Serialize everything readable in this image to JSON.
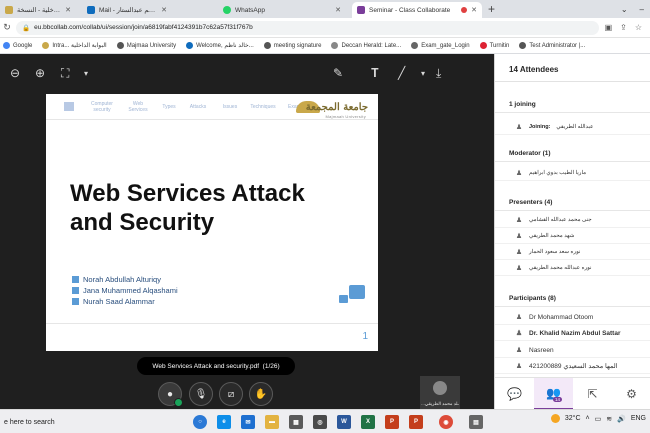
{
  "browser": {
    "tabs": [
      {
        "label": "البوابة الداخلية - النسخة",
        "color": "#c9a84a"
      },
      {
        "label": "Mail - خالد ناظم عبدالستار - Outl",
        "color": "#0f6cbd"
      },
      {
        "label": "WhatsApp",
        "color": "#25d366"
      },
      {
        "label": "Seminar - Class Collaborate",
        "color": "#7a3d9a"
      }
    ],
    "url": "eu.bbcollab.com/collab/ui/session/join/a6819fabf4124391b7c62a57f31f767b",
    "bookmarks": [
      "Google",
      "Intra... البوابة الداخلية",
      "Majmaa University",
      "Welcome, خالد ناظم...",
      "meeting signature",
      "Deccan Herald: Late...",
      "Exam_gate_Login",
      "Turnitin",
      "Test Administrator |..."
    ]
  },
  "slide": {
    "nav": [
      "Computer security",
      "Web Services",
      "Types",
      "Attacks",
      "Issues",
      "Techniques",
      "Examples"
    ],
    "logo_ar": "جامعة المجمعة",
    "logo_en": "Majmaah University",
    "title_line1": "Web Services Attack",
    "title_line2": "and Security",
    "authors": [
      "Norah  Abdullah Alturiqy",
      "Jana Muhammed Alqashami",
      "Nurah Saad Alammar"
    ],
    "page": "1"
  },
  "session": {
    "file": "Web Services Attack and security.pdf",
    "file_pages": "(1/26)",
    "video_name": "...ـلد محمد الطريقي"
  },
  "attendees": {
    "title": "14 Attendees",
    "joining_header": "1 joining",
    "joining_label": "Joining:",
    "joining_name": "عبدالله الطريقي",
    "moderator_header": "Moderator (1)",
    "moderator": "ماريا الطيب بدوي ابراهيم",
    "presenters_header": "Presenters (4)",
    "presenters": [
      "جنى محمد عبدالله القشامي",
      "شهد محمد الطريقي",
      "نوره سعد سعود الحمار",
      "نوره عبدالله محمد الطريقي"
    ],
    "participants_header": "Participants (8)",
    "participants": [
      "Dr Mohammad Otoom",
      "Dr. Khalid Nazim Abdul Sattar",
      "Nasreen",
      "421200889 المها محمد السعيدي"
    ],
    "footer_count": "14"
  },
  "taskbar": {
    "search": "e here to search",
    "temp": "32°C",
    "lang": "ENG"
  },
  "colors": {
    "accent": "#7a3d9a",
    "slide_blue": "#5b9bd5"
  }
}
